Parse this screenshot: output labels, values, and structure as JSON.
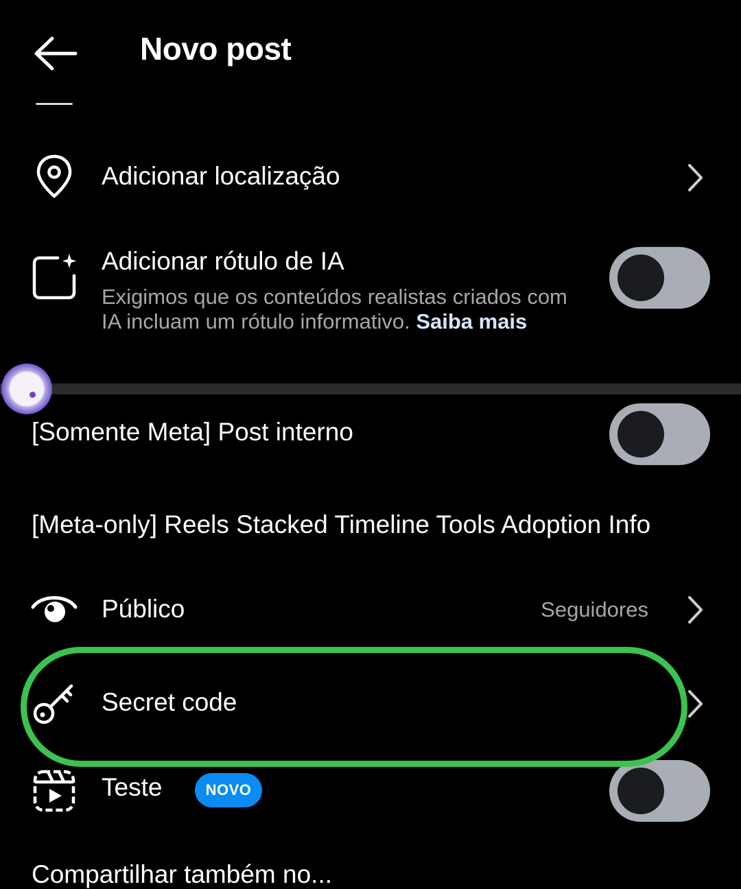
{
  "header": {
    "title": "Novo post",
    "back_icon": "arrow-left-icon"
  },
  "rows": {
    "location": {
      "label": "Adicionar localização",
      "icon": "location-pin-icon"
    },
    "ai_label": {
      "label": "Adicionar rótulo de IA",
      "icon": "ai-sparkle-square-icon",
      "description": "Exigimos que os conteúdos realistas criados com IA incluam um rótulo informativo.",
      "link": "Saiba mais",
      "toggle_on": false
    },
    "internal_post": {
      "label": "[Somente Meta] Post interno",
      "toggle_on": false
    },
    "reels_info": {
      "label": "[Meta-only] Reels Stacked Timeline Tools Adoption Info"
    },
    "audience": {
      "label": "Público",
      "value": "Seguidores",
      "icon": "eye-icon"
    },
    "secret_code": {
      "label": "Secret code",
      "icon": "key-icon",
      "highlight_color": "#3cc24f"
    },
    "test": {
      "label": "Teste",
      "badge": "NOVO",
      "icon": "reels-icon",
      "toggle_on": false
    },
    "share": {
      "label": "Compartilhar também no..."
    }
  },
  "colors": {
    "background": "#000000",
    "toggle_track": "#a9adb6",
    "badge": "#0a8cf4",
    "highlight": "#3cc24f"
  }
}
